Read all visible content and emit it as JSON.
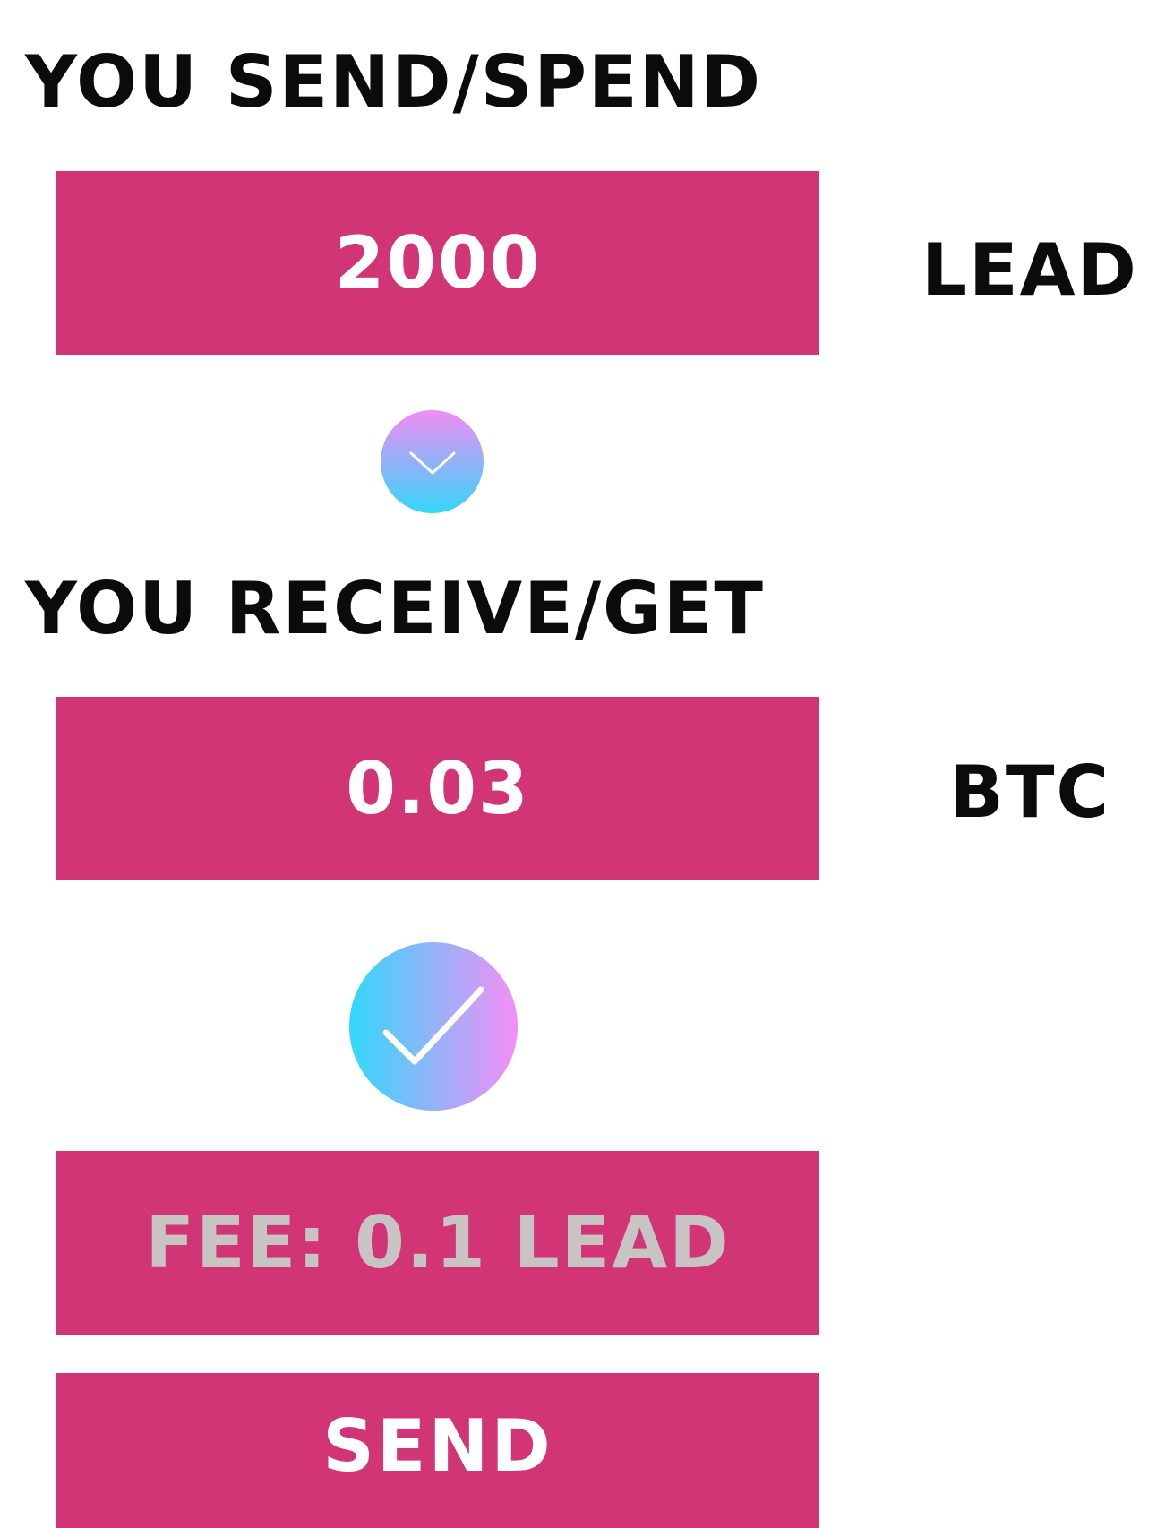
{
  "send_section": {
    "heading": "YOU SEND/SPEND",
    "amount": "2000",
    "unit": "LEAD"
  },
  "receive_section": {
    "heading": "YOU RECEIVE/GET",
    "amount": "0.03",
    "unit": "BTC"
  },
  "fee": {
    "label": "FEE: 0.1 LEAD"
  },
  "action": {
    "send_label": "SEND"
  },
  "icons": {
    "swap": "chevron-down-icon",
    "confirm": "checkmark-icon"
  },
  "colors": {
    "accent": "#d13575",
    "fee_text": "#c9c4c4",
    "gradient_pink": "#f58ef6",
    "gradient_cyan": "#31d8fb"
  }
}
